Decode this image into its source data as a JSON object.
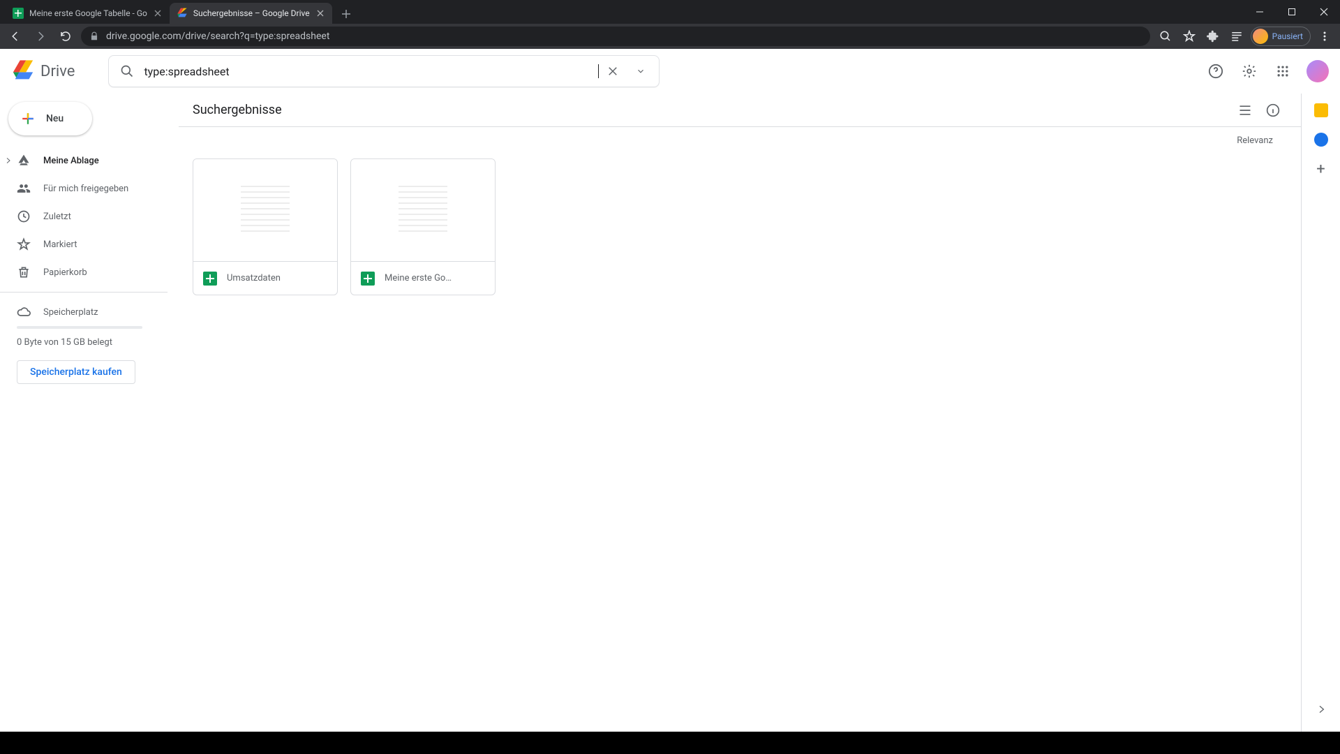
{
  "browser": {
    "tabs": [
      {
        "title": "Meine erste Google Tabelle - Go",
        "favicon": "sheets"
      },
      {
        "title": "Suchergebnisse – Google Drive",
        "favicon": "drive",
        "active": true
      }
    ],
    "url": "drive.google.com/drive/search?q=type:spreadsheet",
    "profile_status": "Pausiert"
  },
  "header": {
    "product": "Drive",
    "search_value": "type:spreadsheet"
  },
  "sidebar": {
    "new_label": "Neu",
    "items": [
      {
        "label": "Meine Ablage",
        "icon": "my-drive",
        "expandable": true
      },
      {
        "label": "Für mich freigegeben",
        "icon": "shared"
      },
      {
        "label": "Zuletzt",
        "icon": "recent"
      },
      {
        "label": "Markiert",
        "icon": "starred"
      },
      {
        "label": "Papierkorb",
        "icon": "trash"
      }
    ],
    "storage_item": {
      "label": "Speicherplatz",
      "icon": "cloud"
    },
    "storage_text": "0 Byte von 15 GB belegt",
    "buy_label": "Speicherplatz kaufen"
  },
  "content": {
    "title": "Suchergebnisse",
    "sort_label": "Relevanz",
    "files": [
      {
        "name": "Umsatzdaten",
        "type": "sheets"
      },
      {
        "name": "Meine erste Go…",
        "type": "sheets"
      }
    ]
  }
}
